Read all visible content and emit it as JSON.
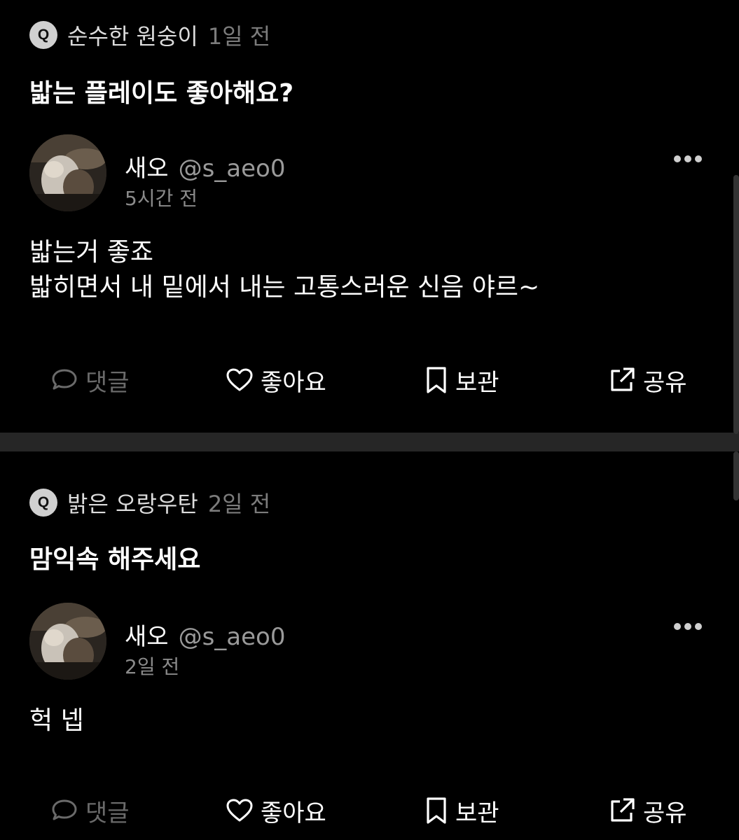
{
  "posts": [
    {
      "question_badge": "Q",
      "question_author": "순수한 원숭이",
      "question_time": "1일 전",
      "question_text": "밟는 플레이도 좋아해요?",
      "user_name": "새오",
      "user_handle": "@s_aeo0",
      "post_time": "5시간 전",
      "answer_lines": [
        "밟는거 좋죠",
        "밟히면서 내 밑에서 내는 고통스러운 신음 야르~"
      ],
      "actions": {
        "comment": "댓글",
        "like": "좋아요",
        "save": "보관",
        "share": "공유"
      }
    },
    {
      "question_badge": "Q",
      "question_author": "밝은 오랑우탄",
      "question_time": "2일 전",
      "question_text": "맘익속 해주세요",
      "user_name": "새오",
      "user_handle": "@s_aeo0",
      "post_time": "2일 전",
      "answer_lines": [
        "헉 넵"
      ],
      "actions": {
        "comment": "댓글",
        "like": "좋아요",
        "save": "보관",
        "share": "공유"
      }
    }
  ],
  "icons": {
    "question": "q-badge-icon",
    "comment": "speech-bubble-icon",
    "like": "heart-outline-icon",
    "save": "bookmark-outline-icon",
    "share": "share-external-icon",
    "more": "more-horizontal-icon"
  },
  "colors": {
    "background": "#000000",
    "divider": "#262626",
    "muted": "#7c7c7c"
  }
}
